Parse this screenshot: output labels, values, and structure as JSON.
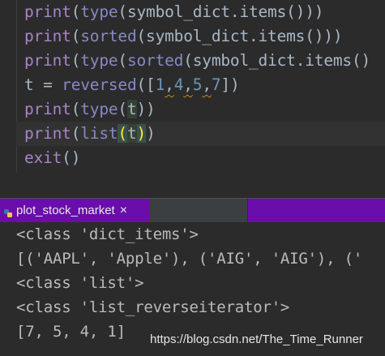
{
  "editor": {
    "lines": [
      {
        "parts": [
          [
            "fn",
            "print"
          ],
          [
            "p",
            "("
          ],
          [
            "bi",
            "type"
          ],
          [
            "p",
            "(symbol_dict.items()))"
          ]
        ]
      },
      {
        "parts": [
          [
            "fn",
            "print"
          ],
          [
            "p",
            "("
          ],
          [
            "bi",
            "sorted"
          ],
          [
            "p",
            "(symbol_dict.items()))"
          ]
        ]
      },
      {
        "parts": [
          [
            "fn",
            "print"
          ],
          [
            "p",
            "("
          ],
          [
            "bi",
            "type"
          ],
          [
            "p",
            "("
          ],
          [
            "bi",
            "sorted"
          ],
          [
            "p",
            "(symbol_dict.items()"
          ]
        ]
      },
      {
        "parts": [
          [
            "p",
            "t = "
          ],
          [
            "bi",
            "reversed"
          ],
          [
            "p",
            "(["
          ],
          [
            "num",
            "1"
          ],
          [
            "wp",
            ","
          ],
          [
            "num",
            "4"
          ],
          [
            "wp",
            ","
          ],
          [
            "num",
            "5"
          ],
          [
            "wp",
            ","
          ],
          [
            "num",
            "7"
          ],
          [
            "p",
            "])"
          ]
        ]
      },
      {
        "parts": [
          [
            "fn",
            "print"
          ],
          [
            "p",
            "("
          ],
          [
            "bi",
            "type"
          ],
          [
            "p",
            "("
          ],
          [
            "vh",
            "t"
          ],
          [
            "p",
            "))"
          ]
        ]
      },
      {
        "parts": [
          [
            "fn",
            "print"
          ],
          [
            "p",
            "("
          ],
          [
            "bi",
            "list"
          ],
          [
            "bh",
            "("
          ],
          [
            "vh",
            "t"
          ],
          [
            "bh",
            ")"
          ],
          [
            "p",
            ")"
          ]
        ],
        "current": true
      },
      {
        "parts": [
          [
            "fn",
            "exit"
          ],
          [
            "p",
            "()"
          ]
        ]
      }
    ]
  },
  "run_tab": {
    "label": "plot_stock_market",
    "close": "×"
  },
  "console": {
    "lines": [
      "<class 'dict_items'>",
      "[('AAPL', 'Apple'), ('AIG', 'AIG'), ('",
      "<class 'list'>",
      "<class 'list_reverseiterator'>",
      "[7, 5, 4, 1]"
    ]
  },
  "watermark": "https://blog.csdn.net/The_Time_Runner",
  "colors": {
    "background": "#2b2b2b",
    "tab_accent": "#6a0dad",
    "function": "#a784c9",
    "builtin": "#8888c6",
    "number": "#6897bb",
    "text": "#a9b7c6",
    "brace_match": "#ffef28"
  }
}
